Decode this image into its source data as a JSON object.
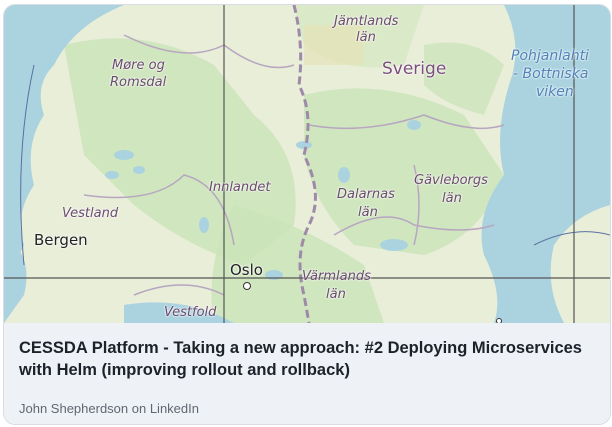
{
  "card": {
    "title": "CESSDA Platform - Taking a new approach: #2 Deploying Microservices with Helm (improving rollout and rollback)",
    "source": "John Shepherdson on LinkedIn"
  },
  "map": {
    "labels": {
      "jamtlands": "Jämtlands",
      "jamtlands_lan": "län",
      "sverige": "Sverige",
      "pohjanlahti1": "Pohjanlahti",
      "pohjanlahti2": "- Bottniska",
      "pohjanlahti3": "viken",
      "more1": "Møre og",
      "more2": "Romsdal",
      "innlandet": "Innlandet",
      "dalarnas": "Dalarnas",
      "dalarnas_lan": "län",
      "gavleborgs": "Gävleborgs",
      "gavleborgs_lan": "län",
      "vestland": "Vestland",
      "bergen": "Bergen",
      "oslo": "Oslo",
      "varmlands": "Värmlands",
      "varmlands_lan": "län",
      "vestfold": "Vestfold"
    }
  },
  "colors": {
    "land": "#e9eed9",
    "forest": "#c9e3b8",
    "water": "#aad3df",
    "border": "#9e8aa8",
    "grid": "#555555",
    "meta_bg": "#eef2f7"
  }
}
